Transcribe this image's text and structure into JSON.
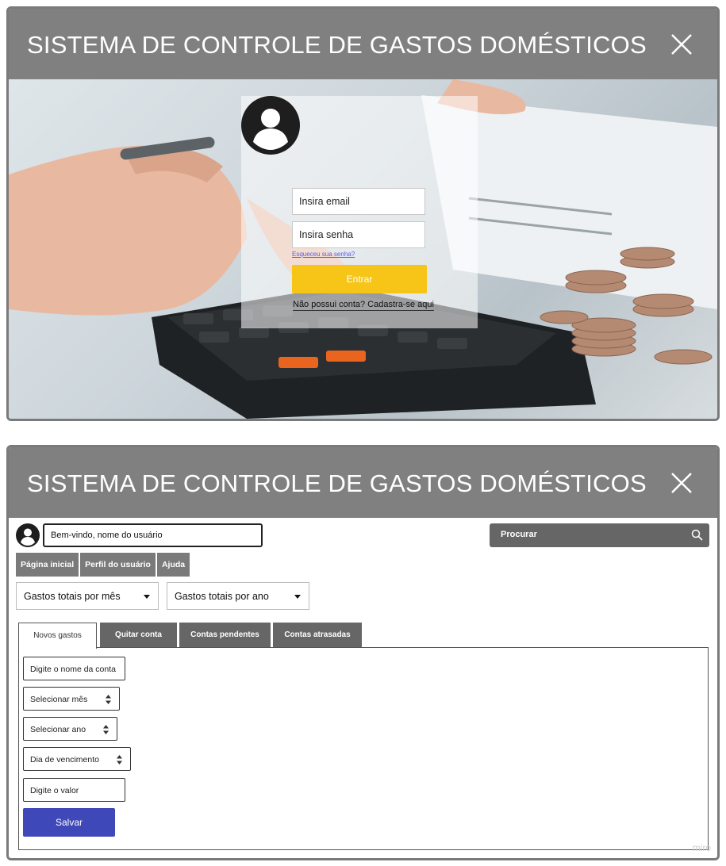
{
  "app_title": "SISTEMA DE CONTROLE DE GASTOS DOMÉSTICOS",
  "login": {
    "email_placeholder": "Insira email",
    "password_placeholder": "Insira senha",
    "forgot_link": "Esqueceu sua senha?",
    "submit_label": "Entrar",
    "signup_link": "Não possui conta? Cadastra-se aqui",
    "background_description_icon": "calculator-photo"
  },
  "dashboard": {
    "welcome_text": "Bem-vindo, nome do usuário",
    "search_label": "Procurar",
    "nav": [
      "Página inicial",
      "Perfil do usuário",
      "Ajuda"
    ],
    "dropdowns": [
      "Gastos totais por mês",
      "Gastos totais por ano"
    ],
    "tabs": [
      "Novos gastos",
      "Quitar conta",
      "Contas pendentes",
      "Contas atrasadas"
    ],
    "active_tab": "Novos gastos",
    "form": {
      "nome_conta": "Digite o nome da conta",
      "mes": "Selecionar mês",
      "ano": "Selecionar ano",
      "vencimento": "Dia de vencimento",
      "valor": "Digite o valor",
      "save_label": "Salvar"
    },
    "watermark": "miro"
  },
  "colors": {
    "titlebar": "#808080",
    "entrar_button": "#f6c518",
    "salvar_button": "#3f48b8",
    "tab_inactive": "#666666"
  }
}
